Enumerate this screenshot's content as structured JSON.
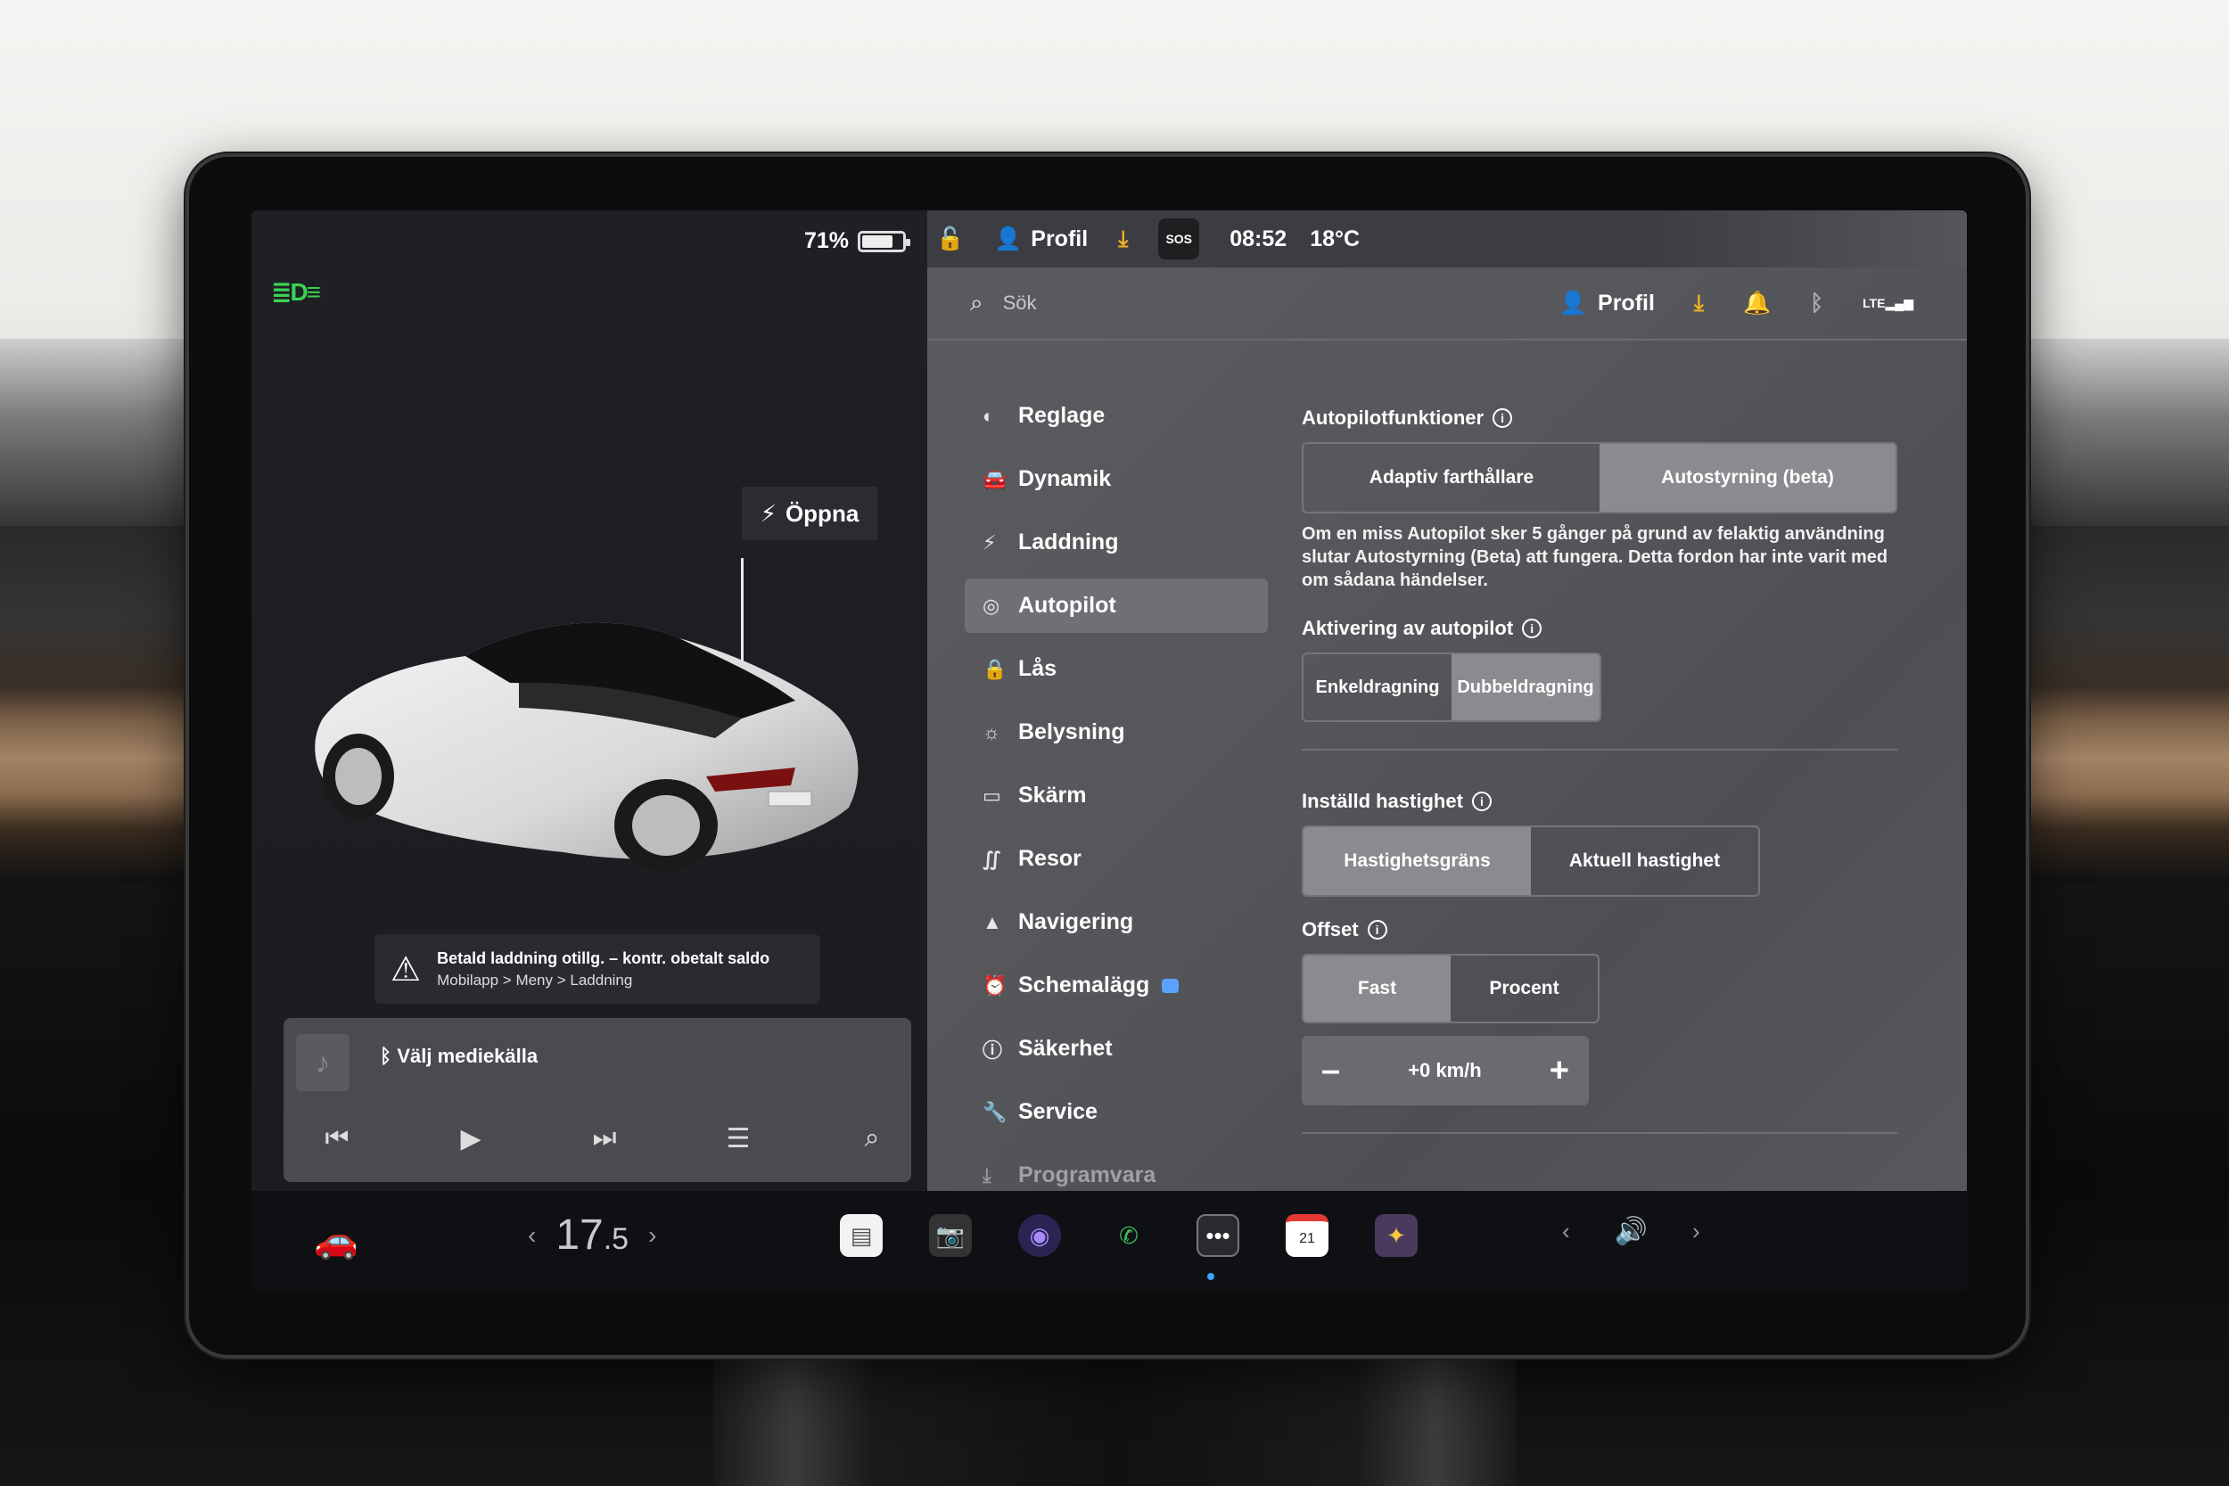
{
  "status": {
    "battery_percent": "71%",
    "battery_level": 0.71
  },
  "left": {
    "open_button": "Öppna",
    "warning": {
      "line1": "Betald laddning otillg. – kontr. obetalt saldo",
      "line2": "Mobilapp > Meny > Laddning"
    },
    "media": {
      "source": "Välj mediekälla"
    }
  },
  "topbar": {
    "profile": "Profil",
    "sos": "SOS",
    "time": "08:52",
    "temperature": "18°C"
  },
  "search": {
    "placeholder": "Sök",
    "profile": "Profil"
  },
  "menu": {
    "items": [
      {
        "label": "Reglage",
        "icon": "toggle-icon"
      },
      {
        "label": "Dynamik",
        "icon": "car-front-icon"
      },
      {
        "label": "Laddning",
        "icon": "bolt-icon"
      },
      {
        "label": "Autopilot",
        "icon": "steering-wheel-icon"
      },
      {
        "label": "Lås",
        "icon": "lock-icon"
      },
      {
        "label": "Belysning",
        "icon": "sun-icon"
      },
      {
        "label": "Skärm",
        "icon": "display-icon"
      },
      {
        "label": "Resor",
        "icon": "trips-icon"
      },
      {
        "label": "Navigering",
        "icon": "navigation-icon"
      },
      {
        "label": "Schemalägg",
        "icon": "alarm-icon"
      },
      {
        "label": "Säkerhet",
        "icon": "info-icon"
      },
      {
        "label": "Service",
        "icon": "wrench-icon"
      },
      {
        "label": "Programvara",
        "icon": "download-icon"
      }
    ],
    "active": "Autopilot"
  },
  "autopilot": {
    "features_title": "Autopilotfunktioner",
    "features_options": [
      "Adaptiv farthållare",
      "Autostyrning (beta)"
    ],
    "features_selected": 1,
    "description": "Om en miss Autopilot sker 5 gånger på grund av felaktig användning slutar Autostyrning (Beta) att fungera. Detta fordon har inte varit med om sådana händelser.",
    "activation_title": "Aktivering av autopilot",
    "activation_options": [
      "Enkeldragning",
      "Dubbeldragning"
    ],
    "activation_selected": 1,
    "speed_title": "Inställd hastighet",
    "speed_options": [
      "Hastighetsgräns",
      "Aktuell hastighet"
    ],
    "speed_selected": 0,
    "offset_title": "Offset",
    "offset_options": [
      "Fast",
      "Procent"
    ],
    "offset_selected": 0,
    "offset_value": "+0 km/h"
  },
  "taskbar": {
    "cabin_temp_main": "17",
    "cabin_temp_decimal": ".5",
    "calendar_day": "21"
  },
  "colors": {
    "accent": "#39d353",
    "download": "#f5b024",
    "active_menu": "#6f7075"
  }
}
